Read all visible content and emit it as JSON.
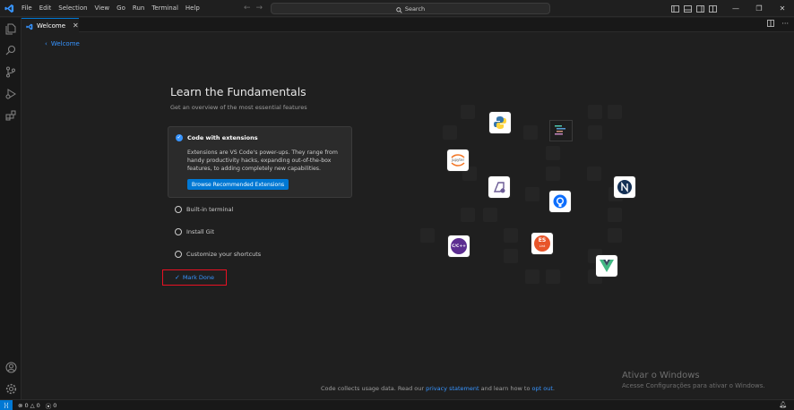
{
  "menu": [
    "File",
    "Edit",
    "Selection",
    "View",
    "Go",
    "Run",
    "Terminal",
    "Help"
  ],
  "search": {
    "label": "Search"
  },
  "tab": {
    "label": "Welcome"
  },
  "breadcrumb": {
    "back_label": "Welcome"
  },
  "walkthrough": {
    "title": "Learn the Fundamentals",
    "subtitle": "Get an overview of the most essential features",
    "active_step": {
      "title": "Code with extensions",
      "description": "Extensions are VS Code's power-ups. They range from handy productivity hacks, expanding out-of-the-box features, to adding completely new capabilities.",
      "button": "Browse Recommended Extensions"
    },
    "steps": [
      "Built-in terminal",
      "Install Git",
      "Customize your shortcuts"
    ],
    "mark_done": "Mark Done"
  },
  "footer": {
    "prefix": "Code collects usage data. Read our",
    "privacy": "privacy statement",
    "middle": "and learn how to",
    "optout": "opt out",
    "suffix": "."
  },
  "watermark": {
    "title": "Ativar o Windows",
    "subtitle": "Acesse Configurações para ativar o Windows."
  },
  "logos": {
    "jupyter": "jupyter",
    "cpp": "C/C++",
    "es": "ES",
    "es_sub": "Lint"
  },
  "status": {
    "errors": "0",
    "warnings": "0",
    "ports": "0"
  },
  "colors": {
    "accent": "#0078d4",
    "link": "#3794ff",
    "highlight_box": "#e81123"
  }
}
